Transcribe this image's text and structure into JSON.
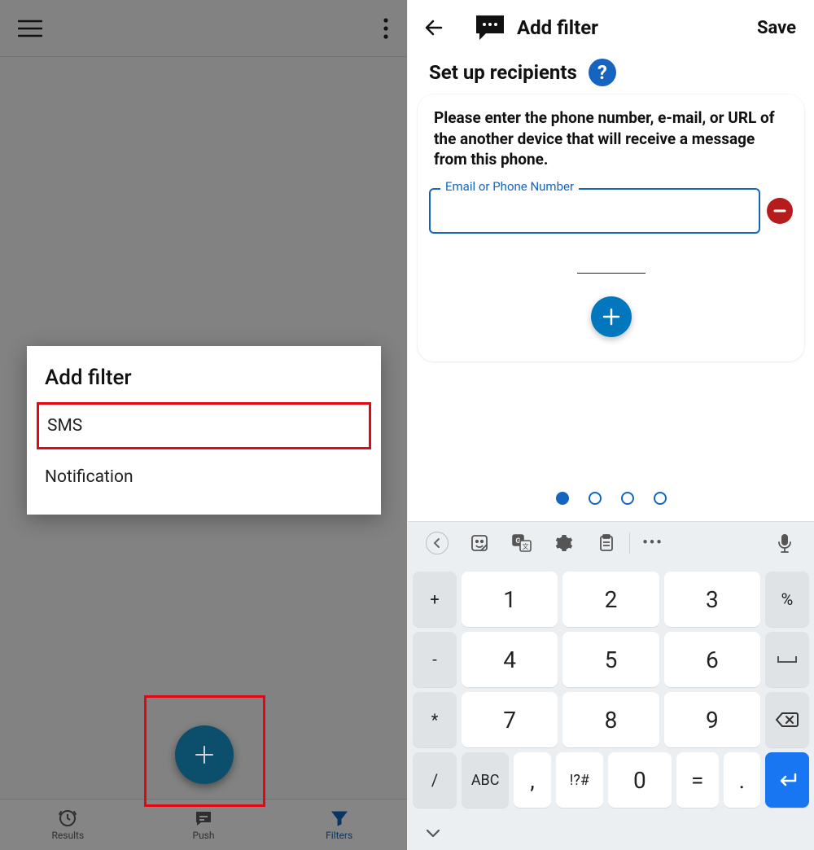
{
  "left": {
    "dialog": {
      "title": "Add filter",
      "options": {
        "sms": "SMS",
        "notification": "Notification"
      }
    },
    "nav": {
      "results": "Results",
      "push": "Push",
      "filters": "Filters"
    }
  },
  "right": {
    "header": {
      "title": "Add filter",
      "save": "Save"
    },
    "section_title": "Set up recipients",
    "help_symbol": "?",
    "card_text": "Please enter the phone number, e-mail, or URL of the another device that will receive a message from this phone.",
    "field_label": "Email or Phone Number",
    "field_value": ""
  },
  "keyboard": {
    "row_side_left": [
      "+",
      "-",
      "*",
      "/"
    ],
    "row_side_right_label_pct": "%",
    "rows": [
      [
        "1",
        "2",
        "3"
      ],
      [
        "4",
        "5",
        "6"
      ],
      [
        "7",
        "8",
        "9"
      ]
    ],
    "bottom": {
      "abc": "ABC",
      "comma": ",",
      "sym": "!?#",
      "zero": "0",
      "eq": "=",
      "dot": "."
    },
    "more": "•••"
  }
}
